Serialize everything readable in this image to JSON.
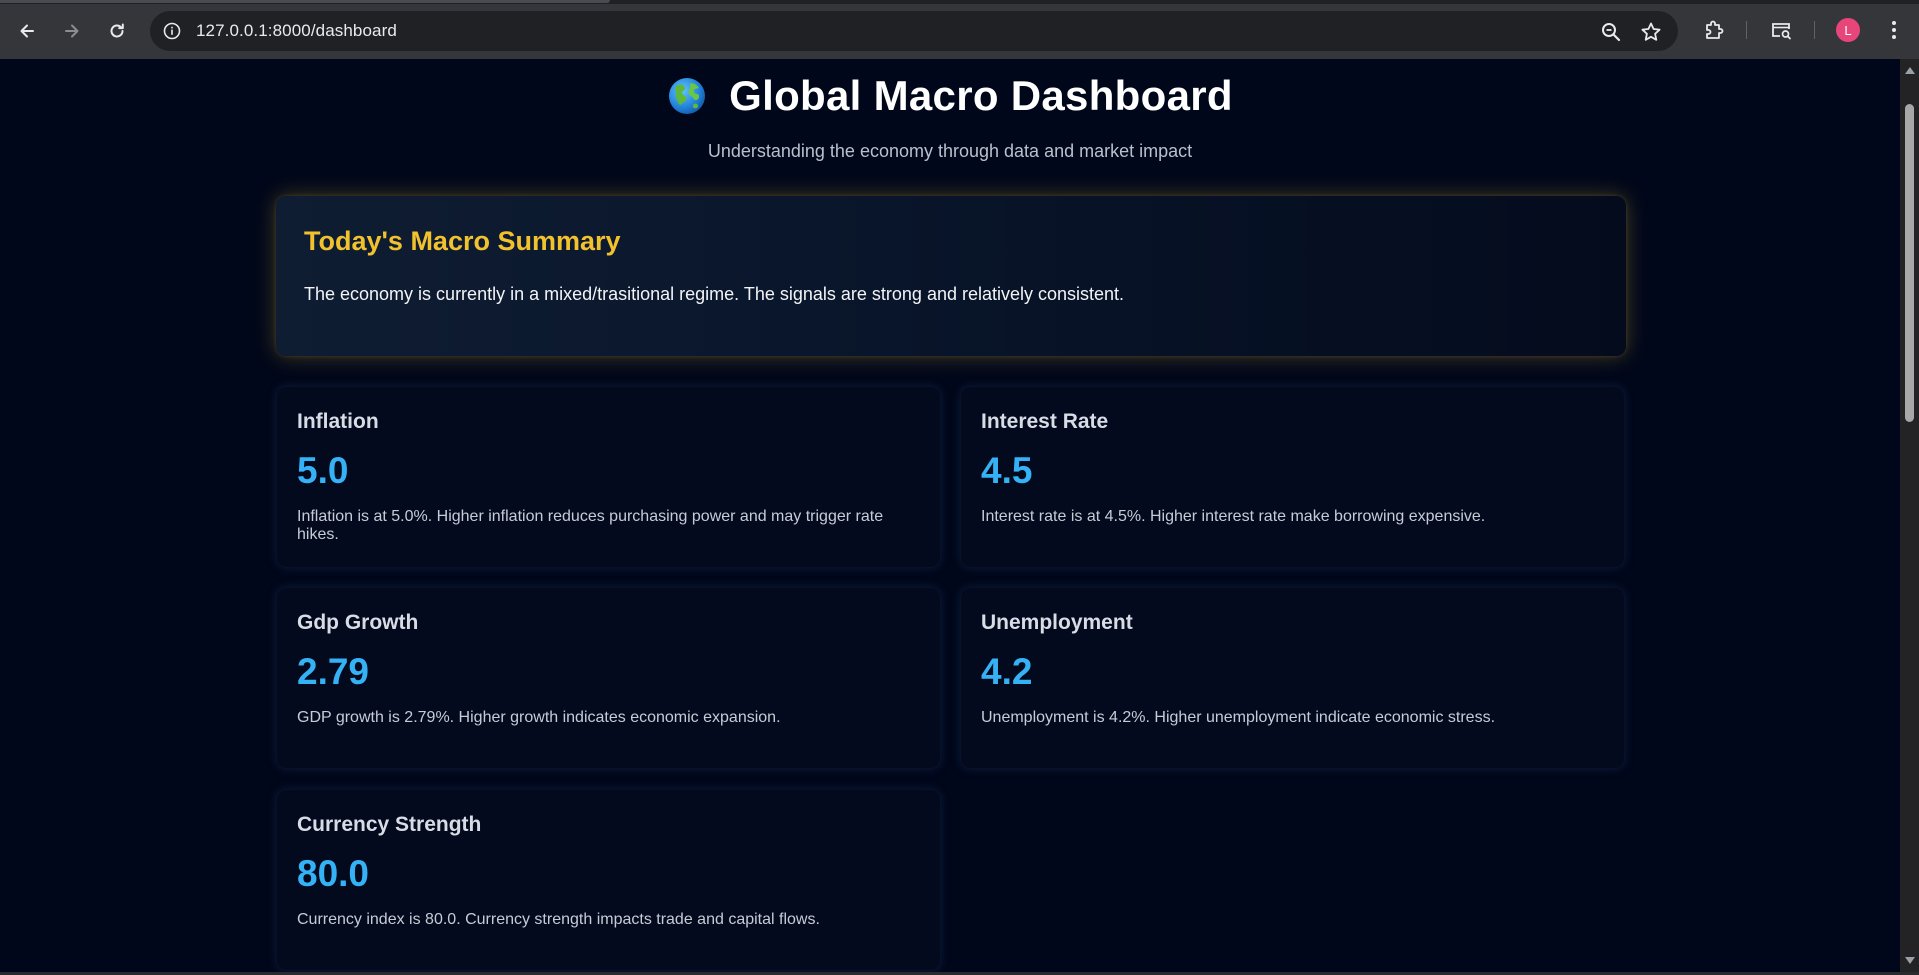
{
  "browser": {
    "url": "127.0.0.1:8000/dashboard",
    "profile_initial": "L",
    "profile_color": "#e8457a",
    "icons": [
      "back-icon",
      "forward-icon",
      "reload-icon",
      "site-info-icon",
      "zoom-icon",
      "bookmark-star-icon",
      "extensions-icon",
      "tab-search-icon",
      "more-menu-icon"
    ]
  },
  "header": {
    "emoji_icon": "globe-icon",
    "title": "Global Macro Dashboard",
    "subtitle": "Understanding the economy through data and market impact"
  },
  "summary": {
    "title": "Today's Macro Summary",
    "text": "The economy is currently in a mixed/trasitional regime. The signals are strong and relatively consistent.",
    "accent_color": "#f2c12e"
  },
  "metrics": [
    {
      "name": "Inflation",
      "value": "5.0",
      "description": "Inflation is at 5.0%. Higher inflation reduces purchasing power and may trigger rate hikes."
    },
    {
      "name": "Interest Rate",
      "value": "4.5",
      "description": "Interest rate is at 4.5%. Higher interest rate make borrowing expensive."
    },
    {
      "name": "Gdp Growth",
      "value": "2.79",
      "description": "GDP growth is 2.79%. Higher growth indicates economic expansion."
    },
    {
      "name": "Unemployment",
      "value": "4.2",
      "description": "Unemployment is 4.2%. Higher unemployment indicate economic stress."
    },
    {
      "name": "Currency Strength",
      "value": "80.0",
      "description": "Currency index is 80.0. Currency strength impacts trade and capital flows."
    }
  ],
  "colors": {
    "background": "#01071a",
    "value_color": "#34b2f5"
  }
}
